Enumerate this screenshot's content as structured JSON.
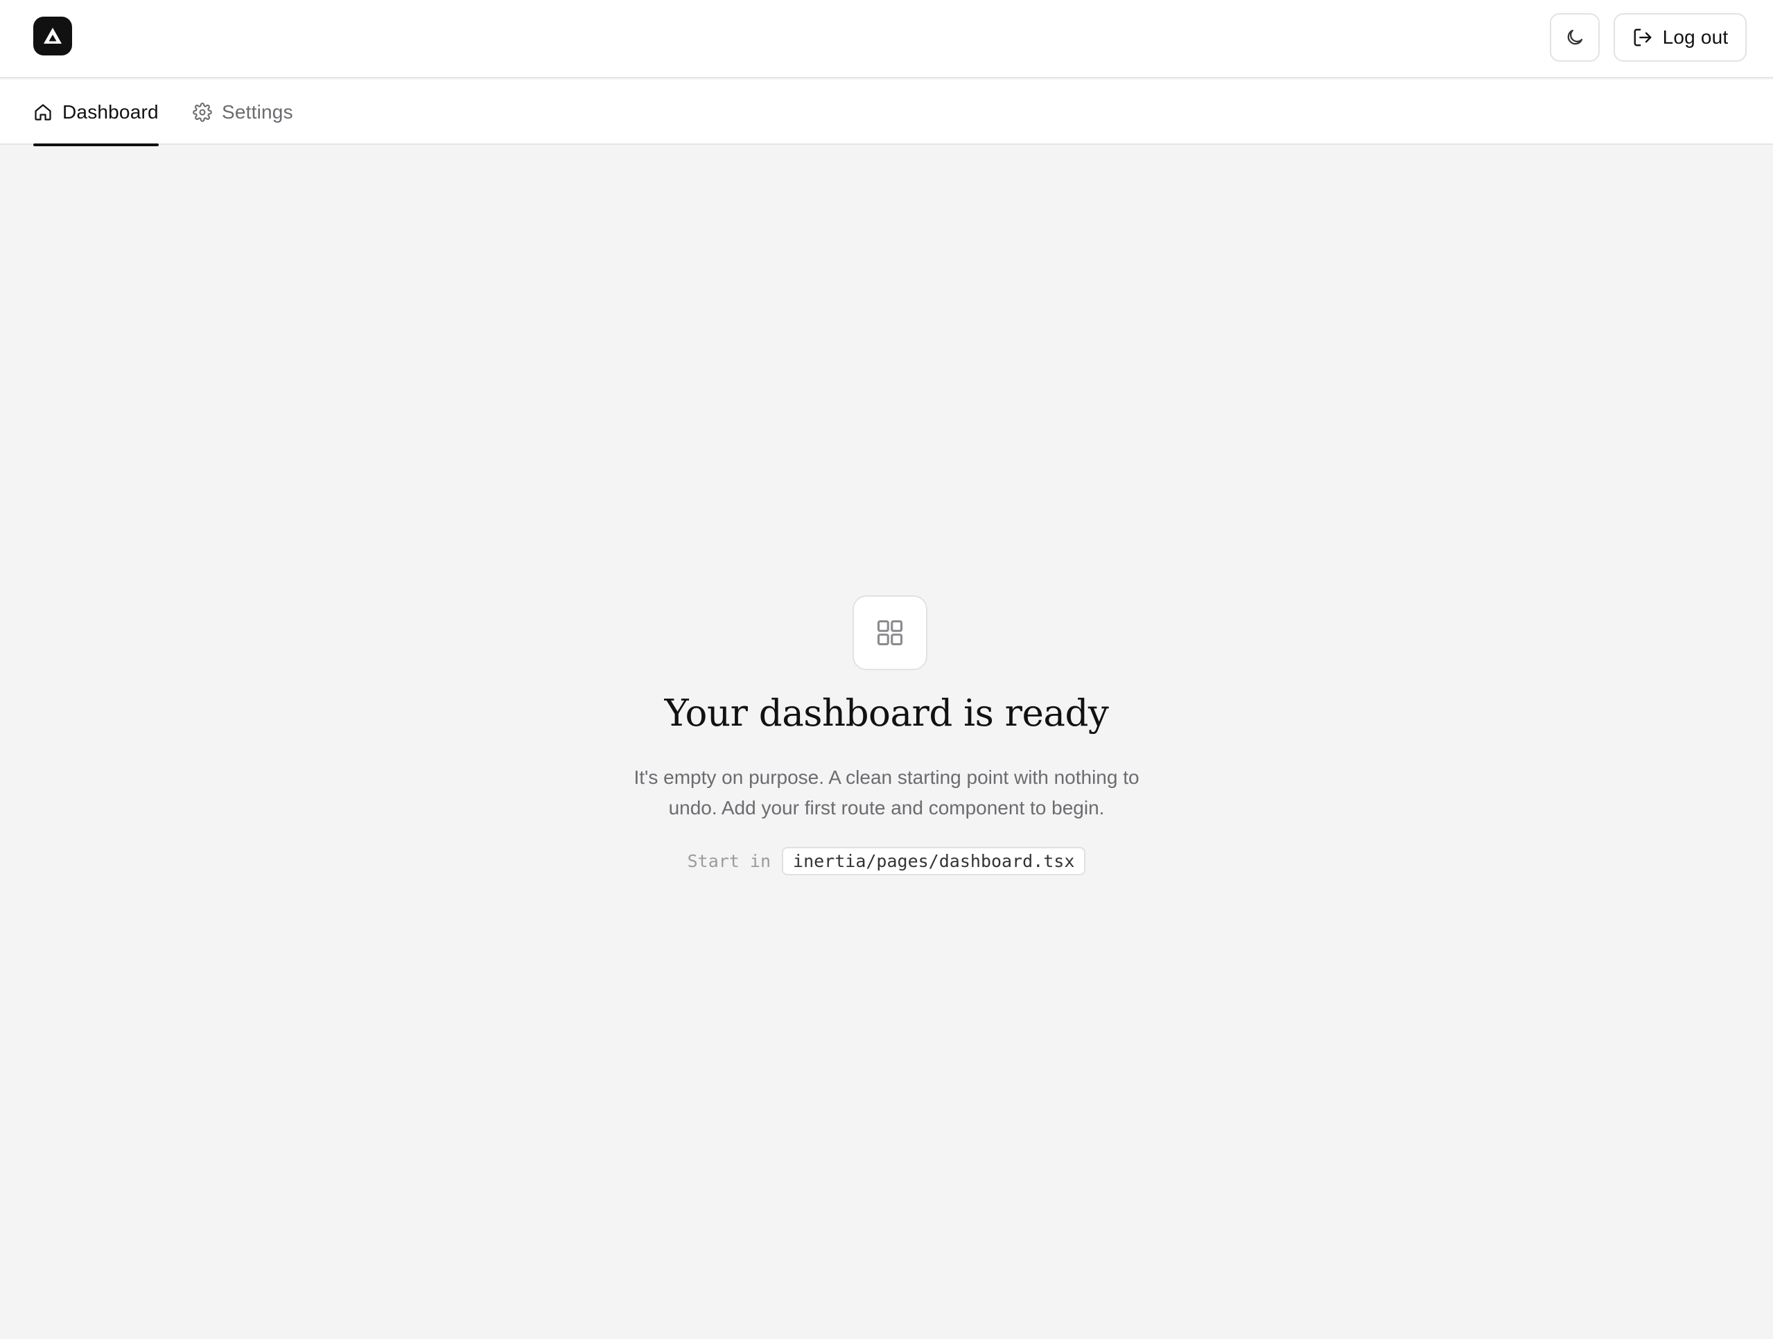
{
  "header": {
    "logo_icon": "app-logo-icon",
    "theme_toggle_icon": "moon-icon",
    "logout_icon": "log-out-icon",
    "logout_label": "Log out"
  },
  "nav": {
    "tabs": [
      {
        "label": "Dashboard",
        "icon": "home-icon",
        "active": true
      },
      {
        "label": "Settings",
        "icon": "gear-icon",
        "active": false
      }
    ]
  },
  "empty_state": {
    "icon": "layout-grid-icon",
    "title": "Your dashboard is ready",
    "description": "It's empty on purpose. A clean starting point with nothing to undo. Add your first route and component to begin.",
    "hint_prefix": "Start in",
    "hint_path": "inertia/pages/dashboard.tsx"
  },
  "colors": {
    "background": "#f4f4f4",
    "surface": "#ffffff",
    "border": "#e6e6e6",
    "text_primary": "#111111",
    "text_muted": "#6b6b70",
    "accent": "#111111"
  }
}
